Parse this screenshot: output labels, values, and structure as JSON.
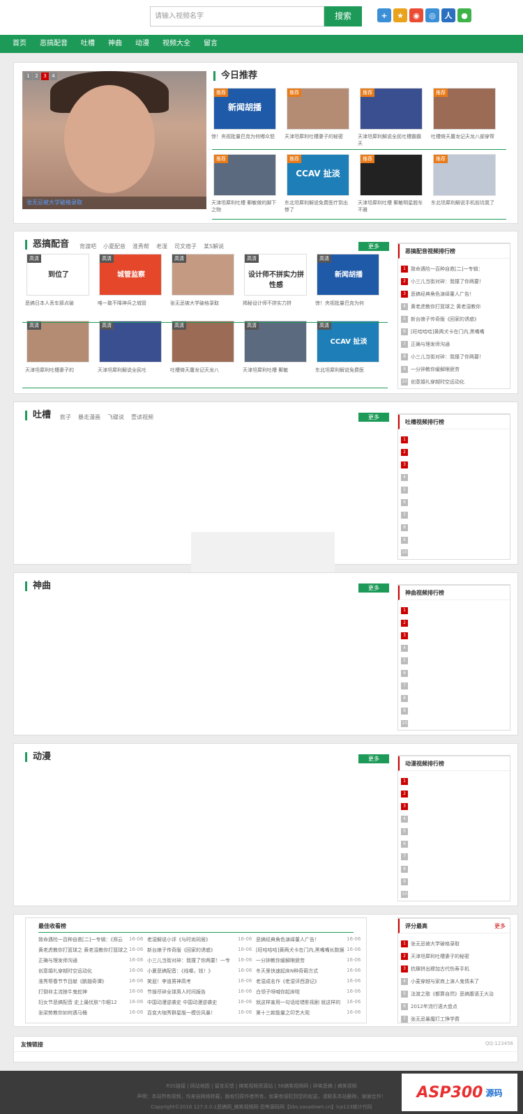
{
  "search": {
    "placeholder": "请输入视频名字",
    "button": "搜索"
  },
  "nav": [
    "首页",
    "恶搞配音",
    "吐槽",
    "神曲",
    "动漫",
    "视频大全",
    "留言"
  ],
  "banner": {
    "pages": [
      "1",
      "2",
      "3",
      "4"
    ],
    "caption": "张无忌被大学破格录取"
  },
  "today": {
    "title": "今日推荐",
    "badge": "推荐",
    "items": [
      {
        "title": "惊！央视批量巴克为何嘟众怒",
        "thumb": "新闻胡播",
        "color": "#1e5aa8"
      },
      {
        "title": "天津坦犀利吐槽妻子的秘密",
        "thumb": "",
        "color": "#b48c74"
      },
      {
        "title": "天津坦犀利解说全民吐槽霸霸天",
        "thumb": "",
        "color": "#3a4f8f"
      },
      {
        "title": "吐槽倚天屠龙记天龙八部穿帮",
        "thumb": "",
        "color": "#9b6b55"
      },
      {
        "title": "天津坦犀利吐槽 郵敏做的脚下之物",
        "thumb": "",
        "color": "#5b6a7e"
      },
      {
        "title": "东北坦犀利解说免费医疗到出惨了",
        "thumb": "CCAV 扯淡",
        "color": "#1e7fb8"
      },
      {
        "title": "天津坦犀利吐槽 郵敏明星脱车不雅",
        "thumb": "",
        "color": "#222"
      },
      {
        "title": "东北坦犀利解说手机前坑我了",
        "thumb": "",
        "color": "#bfc8d4"
      }
    ]
  },
  "egao": {
    "title": "恶搞配音",
    "tags": [
      "背渡吧",
      "小夏配音",
      "淮秀帮",
      "老湿",
      "司文痞子",
      "某S解说"
    ],
    "more": "更多",
    "badge": "高清",
    "items": [
      {
        "title": "恶搞日本人丢车那点破",
        "thumb": "到位了",
        "color": "#fff"
      },
      {
        "title": "唯一敢不降神兵之城管",
        "thumb": "城管监察",
        "color": "#e4472a"
      },
      {
        "title": "张无忌被大学破格录取",
        "thumb": "",
        "color": "#c49a82"
      },
      {
        "title": "揭秘设计师不拼实力拼",
        "thumb": "设计师不拼实力拼性感",
        "color": "#fff"
      },
      {
        "title": "惊！央视批量巴克为何",
        "thumb": "新闻胡播",
        "color": "#1e5aa8"
      },
      {
        "title": "天津坦犀利吐槽妻子的",
        "thumb": "",
        "color": "#b48c74"
      },
      {
        "title": "天津坦犀利解说全民吐",
        "thumb": "",
        "color": "#3a4f8f"
      },
      {
        "title": "吐槽倚天屠龙记天龙八",
        "thumb": "",
        "color": "#9b6b55"
      },
      {
        "title": "天津坦犀利吐槽 郵敏",
        "thumb": "",
        "color": "#5b6a7e"
      },
      {
        "title": "东北坦犀利解说免费医",
        "thumb": "CCAV 扯淡",
        "color": "#1e7fb8"
      }
    ],
    "rank_title": "恶搞配音视频排行榜",
    "rank": [
      "致命遇险一百种自救[二]一专辑：",
      "小三儿当街对碎：我撞了你两要！",
      "恶搞经典角色演绎董人广告！",
      "黄老虎教你打篮球之 黄老湿教你",
      "新台娘子传奇版《回家的诱惑》",
      "[旺哈哈哈]黄两犬卡在门内,黑嘴嘴",
      "正确与理发师沟通",
      "小三儿当街对碎：我撞了你两要！",
      "一分钟教你缓解眼疲劳",
      "创意婚礼穿越时空远动化"
    ]
  },
  "tucao": {
    "title": "吐槽",
    "tags": [
      "款子",
      "暴走漫画",
      "飞碟说",
      "壹读视频"
    ],
    "more": "更多",
    "rank_title": "吐槽视频排行榜"
  },
  "shenqu": {
    "title": "神曲",
    "more": "更多",
    "rank_title": "神曲视频排行榜"
  },
  "dongman": {
    "title": "动漫",
    "more": "更多",
    "rank_title": "动漫视频排行榜"
  },
  "rank_nums": [
    "1",
    "2",
    "3",
    "4",
    "5",
    "6",
    "7",
    "8",
    "9",
    "10"
  ],
  "fav": {
    "title": "最佳收看榜",
    "date": "16-06",
    "cols": [
      [
        "致命遇险一百种自救[二]一专辑：《郑云",
        "黄老虎教你打篮球之 黄老湿教你打篮球之",
        "正确与理发师沟通",
        "创意婚礼穿越时空远动化",
        "淮秀帮春节节目献《鹏翘奇谭》",
        "打倒非主流挫牛鬼蛇神",
        "妇女节恶搞配音 史上最忧肤“巾帼12",
        "张梁势教你如何遇马桶"
      ],
      [
        "老湿解说小评《与时尚同居》",
        "新台娘子传奇版《回家的诱惑》",
        "小三儿当街对碎：我撞了你两要！一专",
        "小夏恶搞配音：《线哪，钱！》",
        "笑屁！李道男神高考",
        "节操尽碎全球男人时间报告",
        "中国动漫逆袭史 中国动漫逆袭史",
        "百变大咖秀群星版一模仿风暴！"
      ],
      [
        "恶搞经典角色演绎董人广告！",
        "[旺哈哈哈]黄两犬卡在门内,黑嘴嘴长数据",
        "一分钟教你缓解眼疲劳",
        "冬天里快速起床N种奇葩方式",
        "老湿成名作《老湿评西游记》",
        "白领子呀喊你起床啦",
        "就这样害用一句话给错影视剧 就这样的",
        "第十三款能量之印艺大观"
      ]
    ]
  },
  "top": {
    "title": "评分最高",
    "more": "更多",
    "items": [
      "张无忌被大学破格录取",
      "天津坦犀利吐槽妻子的秘密",
      "抗肆拼出穆加古代伤寿手机",
      "小麦穿越与家商上演人鬼情未了",
      "法渡之歌《都算自然》恶搞腹语王大治",
      "2012年流行语大盘点",
      "张无忌暴魔打工挣学费"
    ]
  },
  "links": {
    "title": "友情链接",
    "qq": "QQ:123456"
  },
  "footer": {
    "l1": "RSS链接 | 网站地图 | 留言反馈 | 搞笑视频资源站 | 58搞笑视频网 | 碎笑恶搞 | 搞笑视频",
    "l2": "声明：本站所有视频，均来自网络转载，版权归原作者所有，如果有侵犯到您的权益，请联系本站删除，谢谢合作！",
    "l3": "Copyright©2016 127.0.0.1恶搞网_搞笑视频网-恐怖源码网【bbs.sasadown.cn】icp123统计代码",
    "logo": "ASP300",
    "logo2": "源码"
  }
}
